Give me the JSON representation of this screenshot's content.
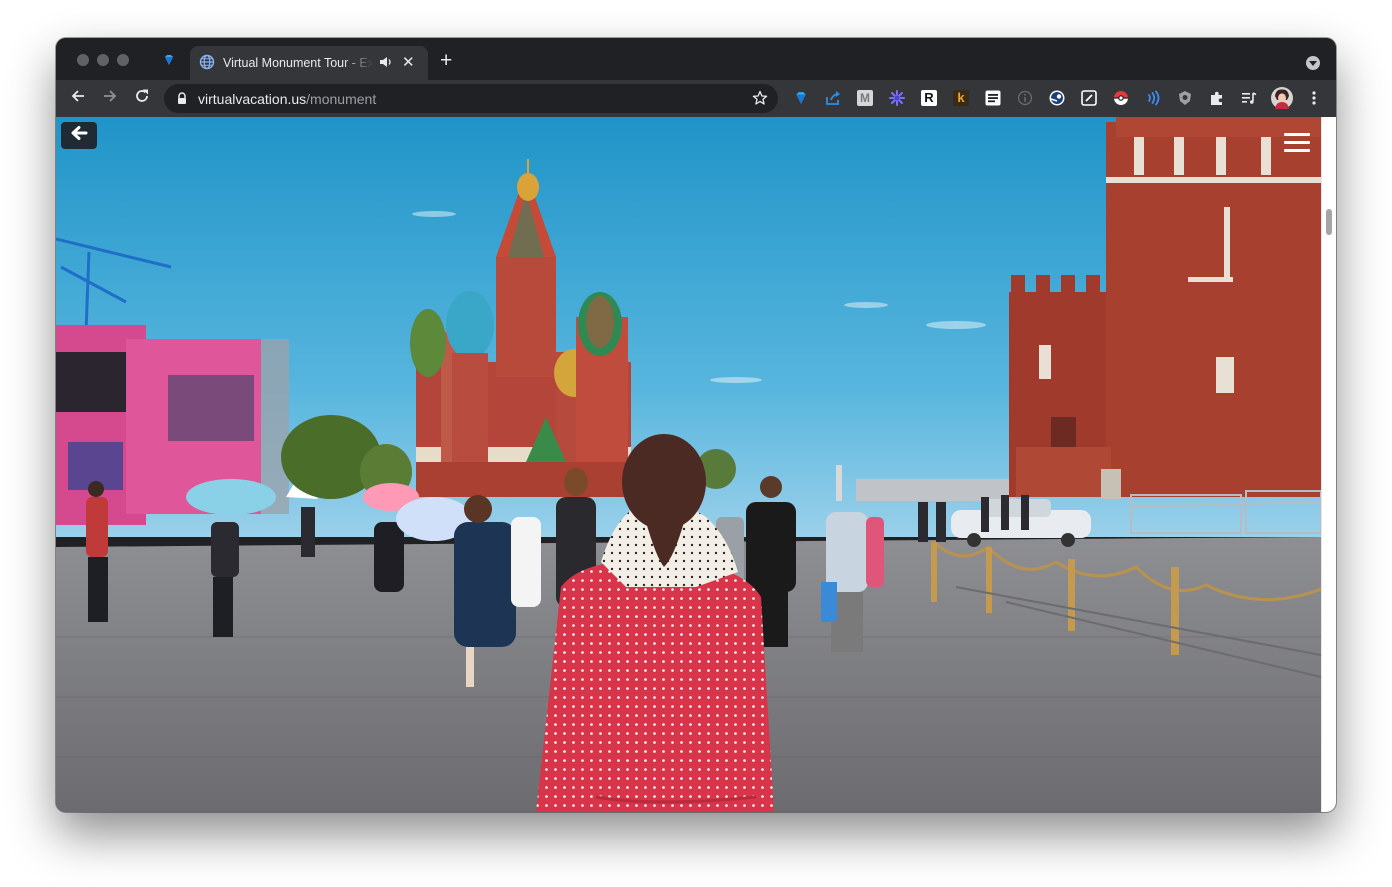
{
  "browser": {
    "tab": {
      "title": "Virtual Monument Tour - Explore",
      "close_glyph": "✕",
      "icon": "globe-icon",
      "audio_icon": "speaker-icon"
    },
    "new_tab_glyph": "+",
    "url": {
      "host": "virtualvacation.us",
      "path": "/monument"
    },
    "extensions": [
      "diamond-icon",
      "share-icon",
      "m-icon",
      "asterisk-icon",
      "r-icon",
      "k-icon",
      "list-icon",
      "info-icon",
      "steam-icon",
      "note-icon",
      "pokeball-icon",
      "signal-icon",
      "shield-icon",
      "puzzle-icon",
      "media-icon",
      "profile-avatar"
    ],
    "ext_letters": {
      "m": "M",
      "r": "R",
      "k": "k"
    }
  },
  "page": {
    "background": "street view of Red Square with St. Basil's Cathedral and the Spasskaya Tower",
    "back_icon": "arrow-left-icon",
    "menu_icon": "hamburger-icon",
    "colors": {
      "sky": "#2a9ed0",
      "plaza": "#7d7f84",
      "tower": "#a03a2c",
      "jacket": "#d8344a"
    }
  }
}
